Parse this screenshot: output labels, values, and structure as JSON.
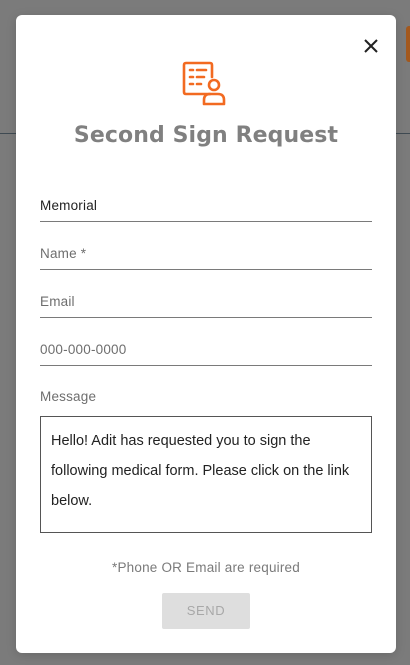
{
  "modal": {
    "title": "Second Sign Request",
    "close_icon": "close-icon",
    "header_icon": "document-person-icon",
    "accent_color": "#f26a21"
  },
  "form": {
    "location_value": "Memorial",
    "name_placeholder": "Name *",
    "email_placeholder": "Email",
    "phone_placeholder": "000-000-0000",
    "message_label": "Message",
    "message_value": "Hello! Adit has requested you to sign the following medical form. Please click on the link below."
  },
  "footer": {
    "required_note": "*Phone OR Email are required",
    "send_label": "SEND"
  }
}
